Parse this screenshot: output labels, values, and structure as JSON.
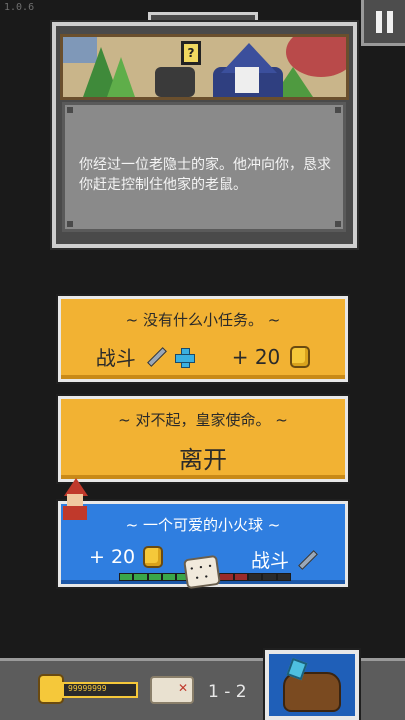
{
  "version": "1.0.6",
  "event": {
    "description": "你经过一位老隐士的家。他冲向你，恳求你赶走控制住他家的老鼠。"
  },
  "choices": [
    {
      "title": "~ 没有什么小任务。 ~",
      "action": "战斗",
      "reward": "+ 20"
    },
    {
      "title": "~ 对不起，皇家使命。 ~",
      "action": "离开"
    },
    {
      "title": "~ 一个可爱的小火球 ~",
      "reward": "+ 20",
      "action": "战斗",
      "chance_segments": [
        "#3aa64a",
        "#3aa64a",
        "#3aa64a",
        "#3aa64a",
        "#3aa64a",
        "#3aa64a",
        "#3aa64a",
        "#9a2a2a",
        "#9a2a2a",
        "#2a2a2a",
        "#2a2a2a",
        "#2a2a2a"
      ]
    }
  ],
  "hud": {
    "gold_count": "99999999",
    "stage": "1 - 2"
  },
  "colors": {
    "gold_button": "#f2b233",
    "blue_button": "#2f7ee0"
  }
}
